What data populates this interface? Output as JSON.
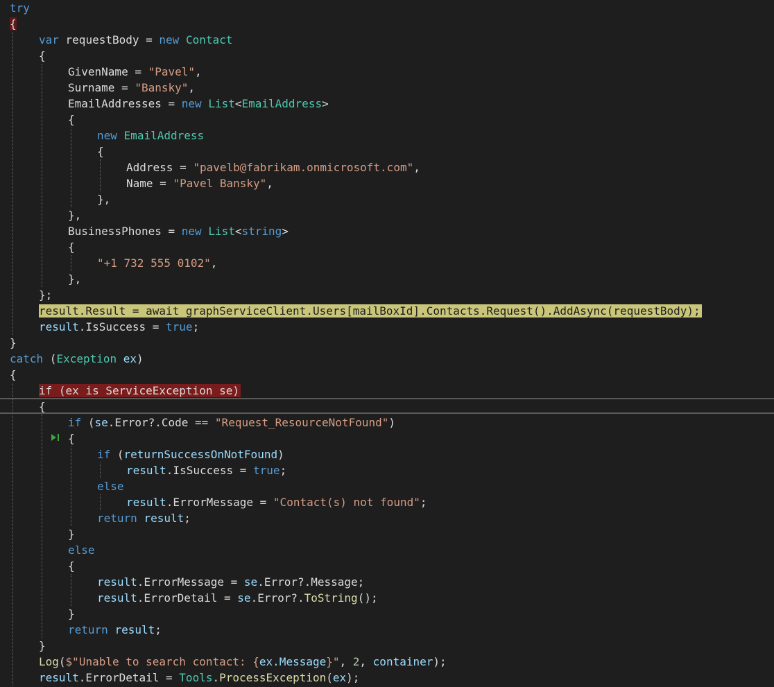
{
  "editor": {
    "lines": [
      [
        {
          "t": "try",
          "c": "kw"
        }
      ],
      [
        {
          "t": "{",
          "c": "punc"
        }
      ],
      [
        {
          "t": "var",
          "c": "kw"
        },
        {
          "t": " requestBody = ",
          "c": "id"
        },
        {
          "t": "new",
          "c": "kw"
        },
        {
          "t": " ",
          "c": "id"
        },
        {
          "t": "Contact",
          "c": "type"
        }
      ],
      [
        {
          "t": "{",
          "c": "punc"
        }
      ],
      [
        {
          "t": "GivenName = ",
          "c": "prop"
        },
        {
          "t": "\"Pavel\"",
          "c": "str"
        },
        {
          "t": ",",
          "c": "punc"
        }
      ],
      [
        {
          "t": "Surname = ",
          "c": "prop"
        },
        {
          "t": "\"Bansky\"",
          "c": "str"
        },
        {
          "t": ",",
          "c": "punc"
        }
      ],
      [
        {
          "t": "EmailAddresses = ",
          "c": "prop"
        },
        {
          "t": "new",
          "c": "kw"
        },
        {
          "t": " ",
          "c": "id"
        },
        {
          "t": "List",
          "c": "type"
        },
        {
          "t": "<",
          "c": "punc"
        },
        {
          "t": "EmailAddress",
          "c": "type"
        },
        {
          "t": ">",
          "c": "punc"
        }
      ],
      [
        {
          "t": "{",
          "c": "punc"
        }
      ],
      [
        {
          "t": "new",
          "c": "kw"
        },
        {
          "t": " ",
          "c": "id"
        },
        {
          "t": "EmailAddress",
          "c": "type"
        }
      ],
      [
        {
          "t": "{",
          "c": "punc"
        }
      ],
      [
        {
          "t": "Address = ",
          "c": "prop"
        },
        {
          "t": "\"pavelb@fabrikam.onmicrosoft.com\"",
          "c": "str"
        },
        {
          "t": ",",
          "c": "punc"
        }
      ],
      [
        {
          "t": "Name = ",
          "c": "prop"
        },
        {
          "t": "\"Pavel Bansky\"",
          "c": "str"
        },
        {
          "t": ",",
          "c": "punc"
        }
      ],
      [
        {
          "t": "},",
          "c": "punc"
        }
      ],
      [
        {
          "t": "},",
          "c": "punc"
        }
      ],
      [
        {
          "t": "BusinessPhones = ",
          "c": "prop"
        },
        {
          "t": "new",
          "c": "kw"
        },
        {
          "t": " ",
          "c": "id"
        },
        {
          "t": "List",
          "c": "type"
        },
        {
          "t": "<",
          "c": "punc"
        },
        {
          "t": "string",
          "c": "kw"
        },
        {
          "t": ">",
          "c": "punc"
        }
      ],
      [
        {
          "t": "{",
          "c": "punc"
        }
      ],
      [
        {
          "t": "\"+1 732 555 0102\"",
          "c": "str"
        },
        {
          "t": ",",
          "c": "punc"
        }
      ],
      [
        {
          "t": "},",
          "c": "punc"
        }
      ],
      [
        {
          "t": "};",
          "c": "punc"
        }
      ],
      [
        {
          "t": "result.Result = await graphServiceClient.Users[mailBoxId].Contacts.Request().AddAsync(requestBody);",
          "c": "id"
        }
      ],
      [
        {
          "t": "result",
          "c": "var"
        },
        {
          "t": ".IsSuccess = ",
          "c": "prop"
        },
        {
          "t": "true",
          "c": "kw"
        },
        {
          "t": ";",
          "c": "punc"
        }
      ],
      [
        {
          "t": "}",
          "c": "punc"
        }
      ],
      [
        {
          "t": "catch",
          "c": "kw"
        },
        {
          "t": " (",
          "c": "punc"
        },
        {
          "t": "Exception",
          "c": "type"
        },
        {
          "t": " ",
          "c": "id"
        },
        {
          "t": "ex",
          "c": "var"
        },
        {
          "t": ")",
          "c": "punc"
        }
      ],
      [
        {
          "t": "{",
          "c": "punc"
        }
      ],
      [
        {
          "t": "if (ex is ServiceException se)",
          "c": "id"
        }
      ],
      [
        {
          "t": "{",
          "c": "punc"
        }
      ],
      [
        {
          "t": "if",
          "c": "kw"
        },
        {
          "t": " (",
          "c": "punc"
        },
        {
          "t": "se",
          "c": "var"
        },
        {
          "t": ".Error?.Code == ",
          "c": "prop"
        },
        {
          "t": "\"Request_ResourceNotFound\"",
          "c": "str"
        },
        {
          "t": ")",
          "c": "punc"
        }
      ],
      [
        {
          "t": "{",
          "c": "punc"
        }
      ],
      [
        {
          "t": "if",
          "c": "kw"
        },
        {
          "t": " (",
          "c": "punc"
        },
        {
          "t": "returnSuccessOnNotFound",
          "c": "var"
        },
        {
          "t": ")",
          "c": "punc"
        }
      ],
      [
        {
          "t": "result",
          "c": "var"
        },
        {
          "t": ".IsSuccess = ",
          "c": "prop"
        },
        {
          "t": "true",
          "c": "kw"
        },
        {
          "t": ";",
          "c": "punc"
        }
      ],
      [
        {
          "t": "else",
          "c": "kw"
        }
      ],
      [
        {
          "t": "result",
          "c": "var"
        },
        {
          "t": ".ErrorMessage = ",
          "c": "prop"
        },
        {
          "t": "\"Contact(s) not found\"",
          "c": "str"
        },
        {
          "t": ";",
          "c": "punc"
        }
      ],
      [
        {
          "t": "return",
          "c": "kw"
        },
        {
          "t": " ",
          "c": "id"
        },
        {
          "t": "result",
          "c": "var"
        },
        {
          "t": ";",
          "c": "punc"
        }
      ],
      [
        {
          "t": "}",
          "c": "punc"
        }
      ],
      [
        {
          "t": "else",
          "c": "kw"
        }
      ],
      [
        {
          "t": "{",
          "c": "punc"
        }
      ],
      [
        {
          "t": "result",
          "c": "var"
        },
        {
          "t": ".ErrorMessage = ",
          "c": "prop"
        },
        {
          "t": "se",
          "c": "var"
        },
        {
          "t": ".Error?.Message;",
          "c": "prop"
        }
      ],
      [
        {
          "t": "result",
          "c": "var"
        },
        {
          "t": ".ErrorDetail = ",
          "c": "prop"
        },
        {
          "t": "se",
          "c": "var"
        },
        {
          "t": ".Error?.",
          "c": "prop"
        },
        {
          "t": "ToString",
          "c": "meth"
        },
        {
          "t": "();",
          "c": "punc"
        }
      ],
      [
        {
          "t": "}",
          "c": "punc"
        }
      ],
      [
        {
          "t": "return",
          "c": "kw"
        },
        {
          "t": " ",
          "c": "id"
        },
        {
          "t": "result",
          "c": "var"
        },
        {
          "t": ";",
          "c": "punc"
        }
      ],
      [
        {
          "t": "}",
          "c": "punc"
        }
      ],
      [
        {
          "t": "Log",
          "c": "meth"
        },
        {
          "t": "(",
          "c": "punc"
        },
        {
          "t": "$\"Unable to search contact: {",
          "c": "str"
        },
        {
          "t": "ex",
          "c": "var"
        },
        {
          "t": ".Message",
          "c": "var"
        },
        {
          "t": "}\"",
          "c": "str"
        },
        {
          "t": ", ",
          "c": "punc"
        },
        {
          "t": "2",
          "c": "num"
        },
        {
          "t": ", ",
          "c": "punc"
        },
        {
          "t": "container",
          "c": "var"
        },
        {
          "t": ");",
          "c": "punc"
        }
      ],
      [
        {
          "t": "result",
          "c": "var"
        },
        {
          "t": ".ErrorDetail = ",
          "c": "prop"
        },
        {
          "t": "Tools",
          "c": "type"
        },
        {
          "t": ".",
          "c": "punc"
        },
        {
          "t": "ProcessException",
          "c": "meth"
        },
        {
          "t": "(",
          "c": "punc"
        },
        {
          "t": "ex",
          "c": "var"
        },
        {
          "t": ");",
          "c": "punc"
        }
      ]
    ],
    "colors": {
      "background": "#1e1e1e",
      "keyword": "#569cd6",
      "type": "#4ec9b0",
      "string": "#d69d85",
      "next_statement_highlight": "#c9c67a",
      "breakpoint_highlight": "#7a1c1c"
    },
    "gutter_icon": "step-into-cursor-icon"
  }
}
